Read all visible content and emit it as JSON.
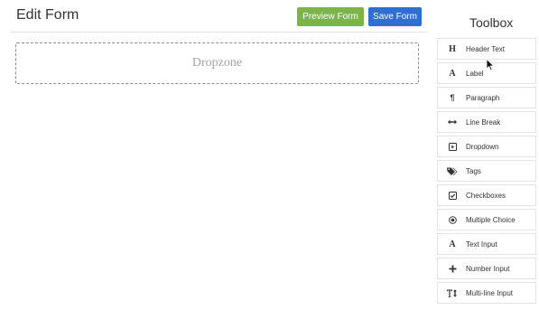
{
  "header": {
    "title": "Edit Form",
    "preview_label": "Preview Form",
    "save_label": "Save Form"
  },
  "dropzone": {
    "label": "Dropzone"
  },
  "toolbox": {
    "title": "Toolbox",
    "items": [
      {
        "label": "Header Text",
        "icon": "heading-icon"
      },
      {
        "label": "Label",
        "icon": "font-icon"
      },
      {
        "label": "Paragraph",
        "icon": "paragraph-icon"
      },
      {
        "label": "Line Break",
        "icon": "arrows-h-icon"
      },
      {
        "label": "Dropdown",
        "icon": "caret-square-icon"
      },
      {
        "label": "Tags",
        "icon": "tags-icon"
      },
      {
        "label": "Checkboxes",
        "icon": "check-square-icon"
      },
      {
        "label": "Multiple Choice",
        "icon": "dot-circle-icon"
      },
      {
        "label": "Text Input",
        "icon": "font-icon"
      },
      {
        "label": "Number Input",
        "icon": "plus-icon"
      },
      {
        "label": "Multi-line Input",
        "icon": "text-height-icon"
      }
    ]
  },
  "colors": {
    "preview_button": "#7cb44a",
    "save_button": "#2f6fd4",
    "dropzone_border": "#8d8d8d"
  }
}
